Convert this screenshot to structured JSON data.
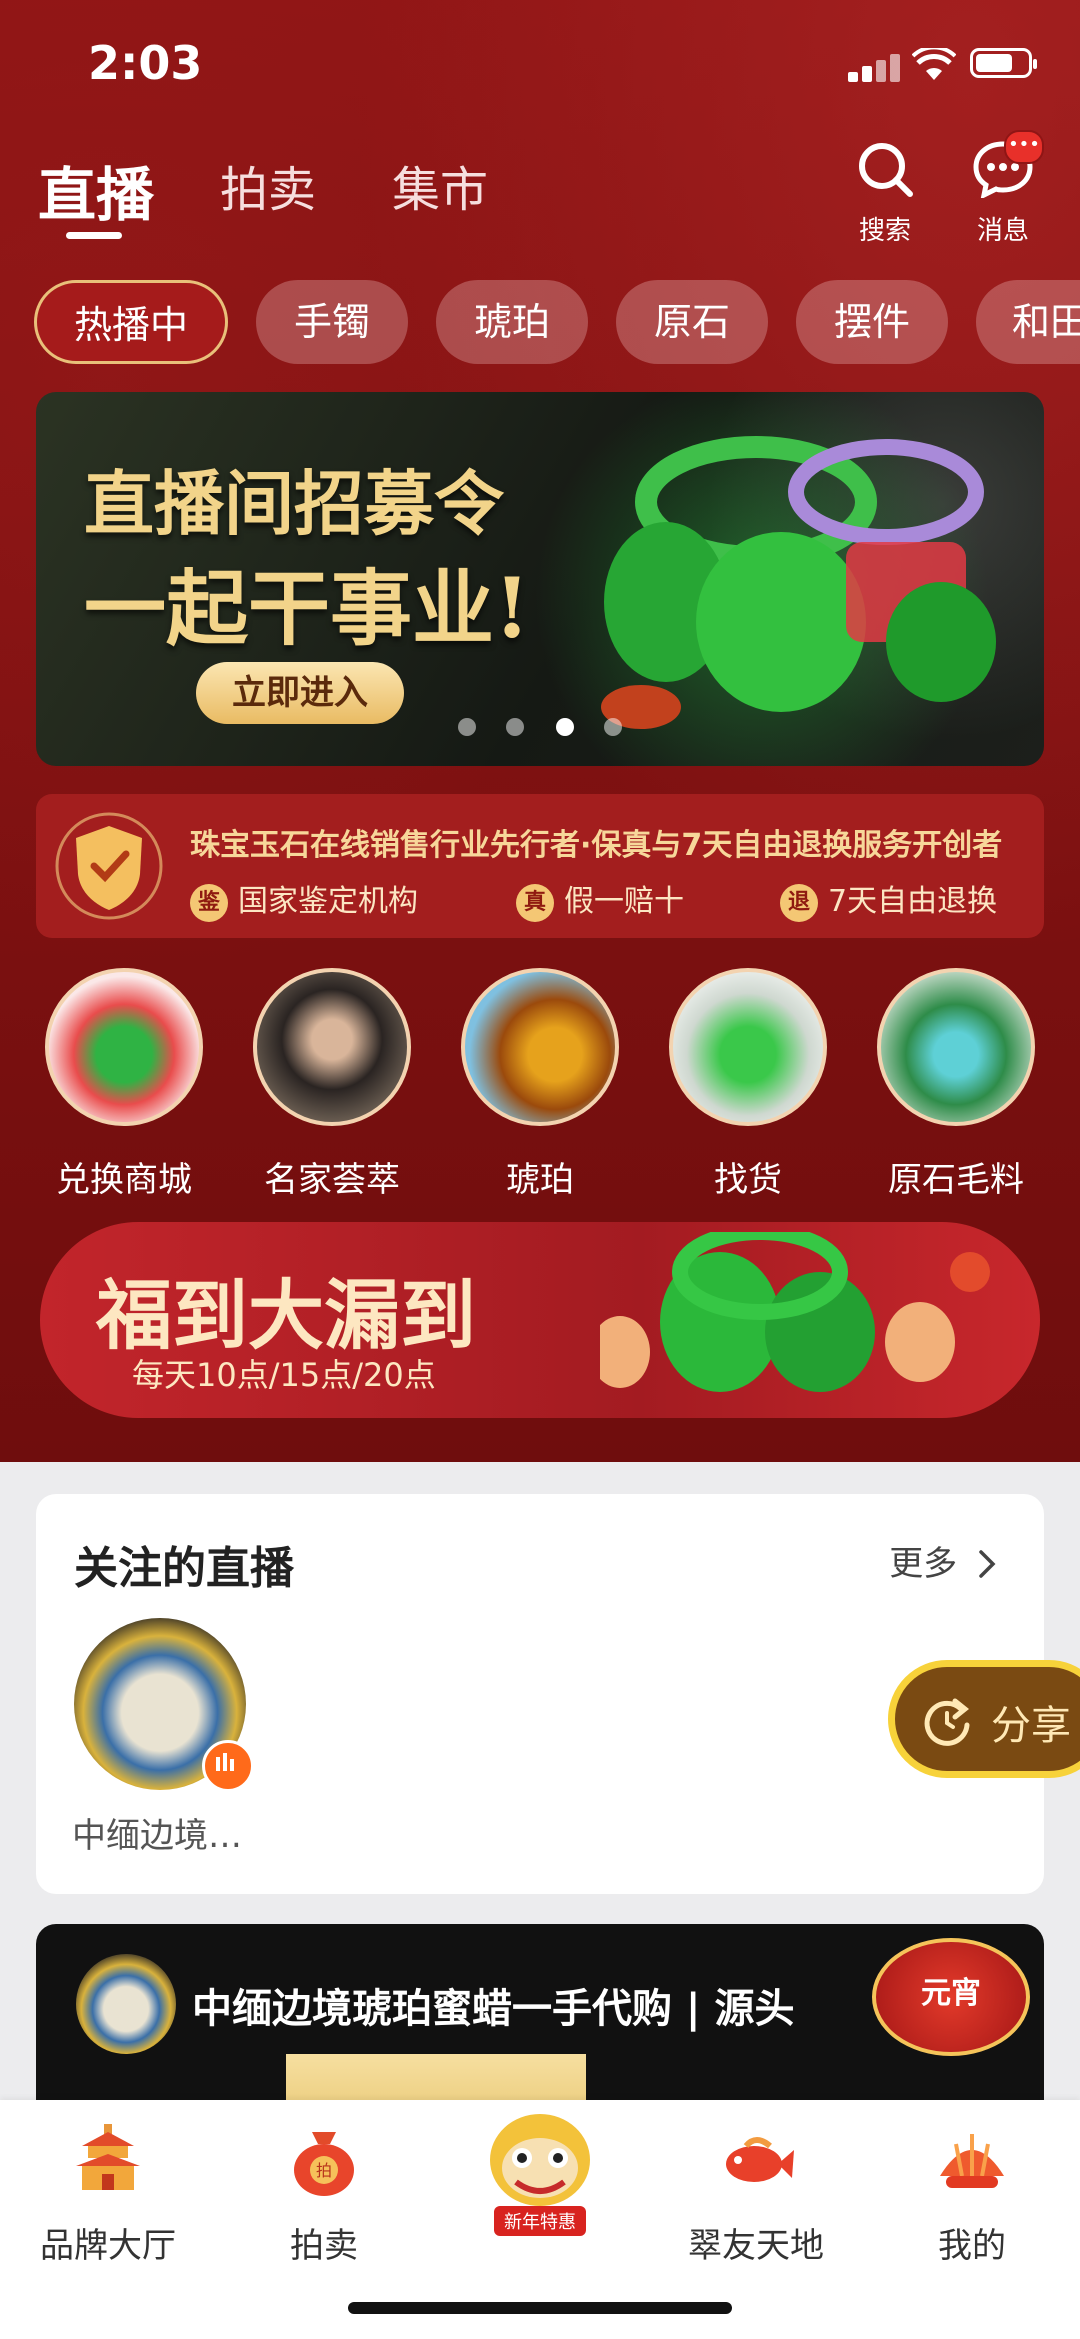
{
  "status_bar": {
    "time": "2:03"
  },
  "top_tabs": [
    {
      "label": "直播",
      "active": true
    },
    {
      "label": "拍卖",
      "active": false
    },
    {
      "label": "集市",
      "active": false
    }
  ],
  "header_actions": {
    "search_label": "搜索",
    "messages_label": "消息",
    "messages_badge": "•••"
  },
  "chips": [
    "热播中",
    "手镯",
    "琥珀",
    "原石",
    "摆件",
    "和田"
  ],
  "banner": {
    "title_line1": "直播间招募令",
    "title_line2": "一起干事业!",
    "button": "立即进入",
    "dots_count": 4,
    "active_dot": 3
  },
  "trust": {
    "headline": "珠宝玉石在线销售行业先行者·保真与7天自由退换服务开创者",
    "items": [
      {
        "badge": "鉴",
        "label": "国家鉴定机构"
      },
      {
        "badge": "真",
        "label": "假一赔十"
      },
      {
        "badge": "退",
        "label": "7天自由退换"
      }
    ]
  },
  "categories": [
    "兑换商城",
    "名家荟萃",
    "琥珀",
    "找货",
    "原石毛料"
  ],
  "promo": {
    "title": "福到大漏到",
    "subtitle": "每天10点/15点/20点"
  },
  "follow_section": {
    "title": "关注的直播",
    "more": "更多",
    "items": [
      {
        "name": "中缅边境…"
      }
    ]
  },
  "share_float": {
    "label": "分享"
  },
  "live_card": {
    "title": "中缅边境琥珀蜜蜡一手代购 | 源头",
    "badge": "元宵"
  },
  "bottom_nav": [
    {
      "label": "品牌大厅"
    },
    {
      "label": "拍卖"
    },
    {
      "label": "新年特惠"
    },
    {
      "label": "翠友天地"
    },
    {
      "label": "我的"
    }
  ],
  "colors": {
    "primary_red": "#8f1515",
    "gold": "#f2d48a",
    "live_orange": "#ff6a1a"
  }
}
